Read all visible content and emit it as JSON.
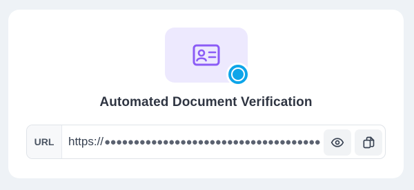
{
  "card": {
    "title": "Automated Document Verification",
    "hero_icon": "id-card-icon",
    "badge_icon": "status-dot-icon"
  },
  "url_field": {
    "label": "URL",
    "value_prefix": "https://",
    "value_masked": "●●●●●●●●●●●●●●●●●●●●●●●●●●●●●●●●●●●●●●",
    "reveal_icon": "eye-icon",
    "copy_icon": "copy-icon"
  },
  "colors": {
    "accent_purple": "#8b5cf6",
    "hero_bg": "#ede9fe",
    "badge_blue": "#0ea5e9"
  }
}
